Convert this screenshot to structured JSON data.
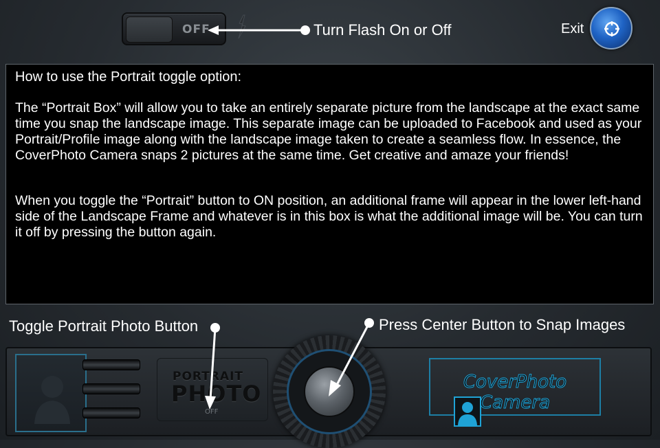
{
  "flash": {
    "state_label": "OFF",
    "annotation": "Turn Flash On or Off"
  },
  "exit": {
    "label": "Exit"
  },
  "help": {
    "heading": "How to use the Portrait toggle option:",
    "paragraph1": "The “Portrait Box” will allow you to take an entirely separate picture from the landscape at the exact same time you snap the landscape image. This separate image can be uploaded to Facebook and used as your Portrait/Profile image along with the landscape image taken to create a seamless flow. In essence, the CoverPhoto Camera snaps 2 pictures at the same time. Get creative and amaze your friends!",
    "paragraph2": "When you toggle the “Portrait” button to ON position, an additional frame will appear in the lower left-hand side of the Landscape Frame and whatever is in this box is what the additional image will be. You can turn it off by pressing the button again."
  },
  "annotations": {
    "portrait_toggle": "Toggle Portrait Photo Button",
    "shutter": "Press Center Button to Snap Images"
  },
  "portrait_button": {
    "line1": "PORTRAIT",
    "line2": "PHOTO",
    "state": "OFF"
  },
  "brand": {
    "text": "CoverPhoto Camera"
  },
  "colors": {
    "accent_blue": "#1fa3d6",
    "panel_bg": "#000000",
    "exit_blue": "#1f63c4"
  },
  "icons": [
    "flash-bolt-icon",
    "exit-crosshair-icon",
    "portrait-silhouette-icon",
    "shutter-icon"
  ]
}
